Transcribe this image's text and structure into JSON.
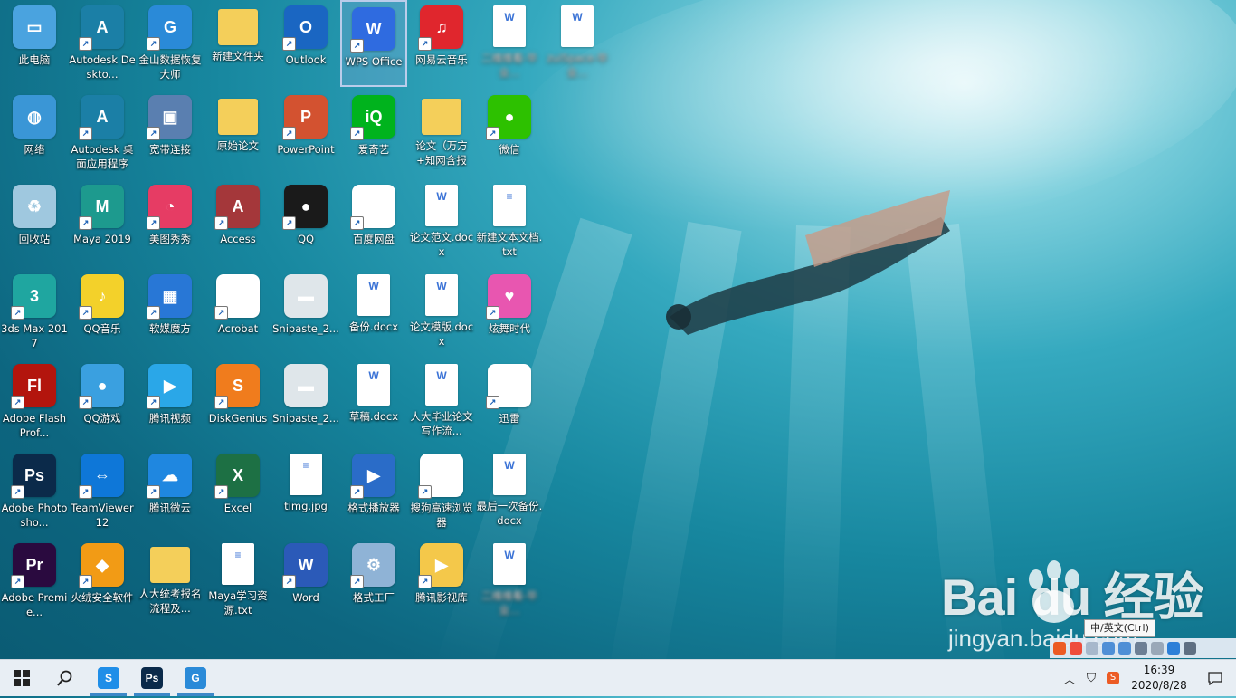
{
  "desktop": {
    "icons": [
      {
        "label": "此电脑",
        "icon": "computer-icon",
        "color": "#4aa3df",
        "glyph": "▭",
        "shortcut": false,
        "blur": false
      },
      {
        "label": "Autodesk Deskto...",
        "icon": "autodesk-icon",
        "color": "#1b7fa6",
        "glyph": "A",
        "shortcut": true,
        "blur": false
      },
      {
        "label": "金山数据恢复大师",
        "icon": "kingsoft-recovery-icon",
        "color": "#2a8ad8",
        "glyph": "G",
        "shortcut": true,
        "blur": false
      },
      {
        "label": "新建文件夹",
        "icon": "folder-icon",
        "color": "#f4cf5a",
        "glyph": "",
        "shortcut": false,
        "blur": false,
        "kind": "folder"
      },
      {
        "label": "Outlook",
        "icon": "outlook-icon",
        "color": "#1a66c2",
        "glyph": "O",
        "shortcut": true,
        "blur": false
      },
      {
        "label": "WPS Office",
        "icon": "wps-office-icon",
        "color": "#2f6be0",
        "glyph": "W",
        "shortcut": true,
        "blur": false,
        "selected": true
      },
      {
        "label": "网易云音乐",
        "icon": "netease-music-icon",
        "color": "#e0262d",
        "glyph": "♫",
        "shortcut": true,
        "blur": false
      },
      {
        "label": "二维维看-毕业…",
        "icon": "word-document-icon",
        "color": "#ffffff",
        "glyph": "W",
        "shortcut": false,
        "blur": true,
        "kind": "doc"
      },
      {
        "label": "zuiSpace-毕业…",
        "icon": "word-document-icon",
        "color": "#ffffff",
        "glyph": "W",
        "shortcut": false,
        "blur": true,
        "kind": "doc"
      },
      {
        "label": "网络",
        "icon": "network-icon",
        "color": "#3a96d6",
        "glyph": "◍",
        "shortcut": false,
        "blur": false
      },
      {
        "label": "Autodesk 桌面应用程序",
        "icon": "autodesk-icon",
        "color": "#1b7fa6",
        "glyph": "A",
        "shortcut": true,
        "blur": false
      },
      {
        "label": "宽带连接",
        "icon": "broadband-icon",
        "color": "#5a7fb0",
        "glyph": "▣",
        "shortcut": true,
        "blur": false
      },
      {
        "label": "原始论文",
        "icon": "folder-icon",
        "color": "#f4cf5a",
        "glyph": "",
        "shortcut": false,
        "blur": false,
        "kind": "folder"
      },
      {
        "label": "PowerPoint",
        "icon": "powerpoint-icon",
        "color": "#d35230",
        "glyph": "P",
        "shortcut": true,
        "blur": false
      },
      {
        "label": "爱奇艺",
        "icon": "iqiyi-icon",
        "color": "#00b31d",
        "glyph": "iQ",
        "shortcut": true,
        "blur": false
      },
      {
        "label": "论文（万方+知网含报告...",
        "icon": "zip-folder-icon",
        "color": "#e9c15a",
        "glyph": "",
        "shortcut": false,
        "blur": false,
        "kind": "folder"
      },
      {
        "label": "微信",
        "icon": "wechat-icon",
        "color": "#2dc100",
        "glyph": "●",
        "shortcut": true,
        "blur": false
      },
      {
        "label": "回收站",
        "icon": "recycle-bin-icon",
        "color": "#9fc8df",
        "glyph": "♻",
        "shortcut": false,
        "blur": false
      },
      {
        "label": "Maya 2019",
        "icon": "maya-icon",
        "color": "#1d9a8e",
        "glyph": "M",
        "shortcut": true,
        "blur": false
      },
      {
        "label": "美图秀秀",
        "icon": "meitu-icon",
        "color": "#e63c64",
        "glyph": "◔",
        "shortcut": true,
        "blur": false
      },
      {
        "label": "Access",
        "icon": "access-icon",
        "color": "#a4373a",
        "glyph": "A",
        "shortcut": true,
        "blur": false
      },
      {
        "label": "QQ",
        "icon": "qq-icon",
        "color": "#1a1a1a",
        "glyph": "●",
        "shortcut": true,
        "blur": false
      },
      {
        "label": "百度网盘",
        "icon": "baidu-netdisk-icon",
        "color": "#ffffff",
        "glyph": "∞",
        "shortcut": true,
        "blur": false
      },
      {
        "label": "论文范文.docx",
        "icon": "word-document-icon",
        "color": "#ffffff",
        "glyph": "W",
        "shortcut": false,
        "blur": false,
        "kind": "doc"
      },
      {
        "label": "新建文本文档.txt",
        "icon": "text-document-icon",
        "color": "#ffffff",
        "glyph": "≡",
        "shortcut": false,
        "blur": false,
        "kind": "doc"
      },
      {
        "label": "3ds Max 2017",
        "icon": "3dsmax-icon",
        "color": "#1fa6a0",
        "glyph": "3",
        "shortcut": true,
        "blur": false
      },
      {
        "label": "QQ音乐",
        "icon": "qq-music-icon",
        "color": "#f3d12a",
        "glyph": "♪",
        "shortcut": true,
        "blur": false
      },
      {
        "label": "软媒魔方",
        "icon": "ruanmei-cube-icon",
        "color": "#2877d6",
        "glyph": "▦",
        "shortcut": true,
        "blur": false
      },
      {
        "label": "Acrobat",
        "icon": "acrobat-icon",
        "color": "#ffffff",
        "glyph": "A",
        "shortcut": true,
        "blur": false
      },
      {
        "label": "Snipaste_2...",
        "icon": "image-file-icon",
        "color": "#dfe6ea",
        "glyph": "▬",
        "shortcut": false,
        "blur": false
      },
      {
        "label": "备份.docx",
        "icon": "word-document-icon",
        "color": "#ffffff",
        "glyph": "W",
        "shortcut": false,
        "blur": false,
        "kind": "doc"
      },
      {
        "label": "论文模版.docx",
        "icon": "word-document-icon",
        "color": "#ffffff",
        "glyph": "W",
        "shortcut": false,
        "blur": false,
        "kind": "doc"
      },
      {
        "label": "炫舞时代",
        "icon": "dance-heart-icon",
        "color": "#e856b0",
        "glyph": "♥",
        "shortcut": true,
        "blur": false
      },
      {
        "label": "Adobe Flash Prof...",
        "icon": "flash-icon",
        "color": "#b3150d",
        "glyph": "Fl",
        "shortcut": true,
        "blur": false
      },
      {
        "label": "QQ游戏",
        "icon": "qq-game-icon",
        "color": "#3aa0e0",
        "glyph": "●",
        "shortcut": true,
        "blur": false
      },
      {
        "label": "腾讯视频",
        "icon": "tencent-video-icon",
        "color": "#2aa7e8",
        "glyph": "▶",
        "shortcut": true,
        "blur": false
      },
      {
        "label": "DiskGenius",
        "icon": "diskgenius-icon",
        "color": "#f07c1d",
        "glyph": "S",
        "shortcut": true,
        "blur": false
      },
      {
        "label": "Snipaste_2...",
        "icon": "image-file-icon",
        "color": "#dfe6ea",
        "glyph": "▬",
        "shortcut": false,
        "blur": false
      },
      {
        "label": "草稿.docx",
        "icon": "word-document-icon",
        "color": "#ffffff",
        "glyph": "W",
        "shortcut": false,
        "blur": false,
        "kind": "doc"
      },
      {
        "label": "人大毕业论文写作流...",
        "icon": "word-document-icon",
        "color": "#ffffff",
        "glyph": "W",
        "shortcut": false,
        "blur": false,
        "kind": "doc"
      },
      {
        "label": "迅雷",
        "icon": "xunlei-icon",
        "color": "#ffffff",
        "glyph": "➤",
        "shortcut": true,
        "blur": false
      },
      {
        "label": "Adobe Photosho...",
        "icon": "photoshop-icon",
        "color": "#0b2a4a",
        "glyph": "Ps",
        "shortcut": true,
        "blur": false
      },
      {
        "label": "TeamViewer 12",
        "icon": "teamviewer-icon",
        "color": "#0e77d8",
        "glyph": "⇔",
        "shortcut": true,
        "blur": false
      },
      {
        "label": "腾讯微云",
        "icon": "weiyun-icon",
        "color": "#1f87e0",
        "glyph": "☁",
        "shortcut": true,
        "blur": false
      },
      {
        "label": "Excel",
        "icon": "excel-icon",
        "color": "#1d7044",
        "glyph": "X",
        "shortcut": true,
        "blur": false
      },
      {
        "label": "timg.jpg",
        "icon": "image-file-icon",
        "color": "#ffffff",
        "glyph": "≡",
        "shortcut": false,
        "blur": false,
        "kind": "doc"
      },
      {
        "label": "格式播放器",
        "icon": "format-player-icon",
        "color": "#2a6cc8",
        "glyph": "▶",
        "shortcut": true,
        "blur": false
      },
      {
        "label": "搜狗高速浏览器",
        "icon": "sogou-browser-icon",
        "color": "#ffffff",
        "glyph": "S",
        "shortcut": true,
        "blur": false
      },
      {
        "label": "最后一次备份.docx",
        "icon": "word-document-icon",
        "color": "#ffffff",
        "glyph": "W",
        "shortcut": false,
        "blur": false,
        "kind": "doc"
      },
      {
        "label": "Adobe Premie...",
        "icon": "premiere-icon",
        "color": "#2a0a3f",
        "glyph": "Pr",
        "shortcut": true,
        "blur": false
      },
      {
        "label": "火绒安全软件",
        "icon": "huorong-icon",
        "color": "#f29b15",
        "glyph": "◆",
        "shortcut": true,
        "blur": false
      },
      {
        "label": "人大统考报名流程及...",
        "icon": "folder-icon",
        "color": "#f4cf5a",
        "glyph": "",
        "shortcut": false,
        "blur": false,
        "kind": "folder"
      },
      {
        "label": "Maya学习资源.txt",
        "icon": "text-document-icon",
        "color": "#ffffff",
        "glyph": "≡",
        "shortcut": false,
        "blur": false,
        "kind": "doc"
      },
      {
        "label": "Word",
        "icon": "word-icon",
        "color": "#2b5ab8",
        "glyph": "W",
        "shortcut": true,
        "blur": false
      },
      {
        "label": "格式工厂",
        "icon": "format-factory-icon",
        "color": "#8fb3d6",
        "glyph": "⚙",
        "shortcut": true,
        "blur": false
      },
      {
        "label": "腾讯影视库",
        "icon": "tencent-video-library-icon",
        "color": "#f4c84a",
        "glyph": "▶",
        "shortcut": true,
        "blur": false
      },
      {
        "label": "二维维看-毕业…",
        "icon": "word-document-icon",
        "color": "#ffffff",
        "glyph": "W",
        "shortcut": false,
        "blur": true,
        "kind": "doc"
      }
    ]
  },
  "watermark": {
    "main": "Bai du 经验",
    "sub": "jingyan.baidu.com"
  },
  "ime": {
    "tooltip": "中/英文(Ctrl)"
  },
  "taskbar": {
    "start": "windows-start-icon",
    "search": "search-icon",
    "apps": [
      {
        "name": "sogou-browser-task-icon",
        "glyph": "S",
        "color": "#1f8ee8"
      },
      {
        "name": "photoshop-task-icon",
        "glyph": "Ps",
        "color": "#0b2a4a"
      },
      {
        "name": "kingsoft-recovery-task-icon",
        "glyph": "G",
        "color": "#2a8ad8"
      }
    ],
    "clock": {
      "time": "16:39",
      "date": "2020/8/28"
    }
  }
}
